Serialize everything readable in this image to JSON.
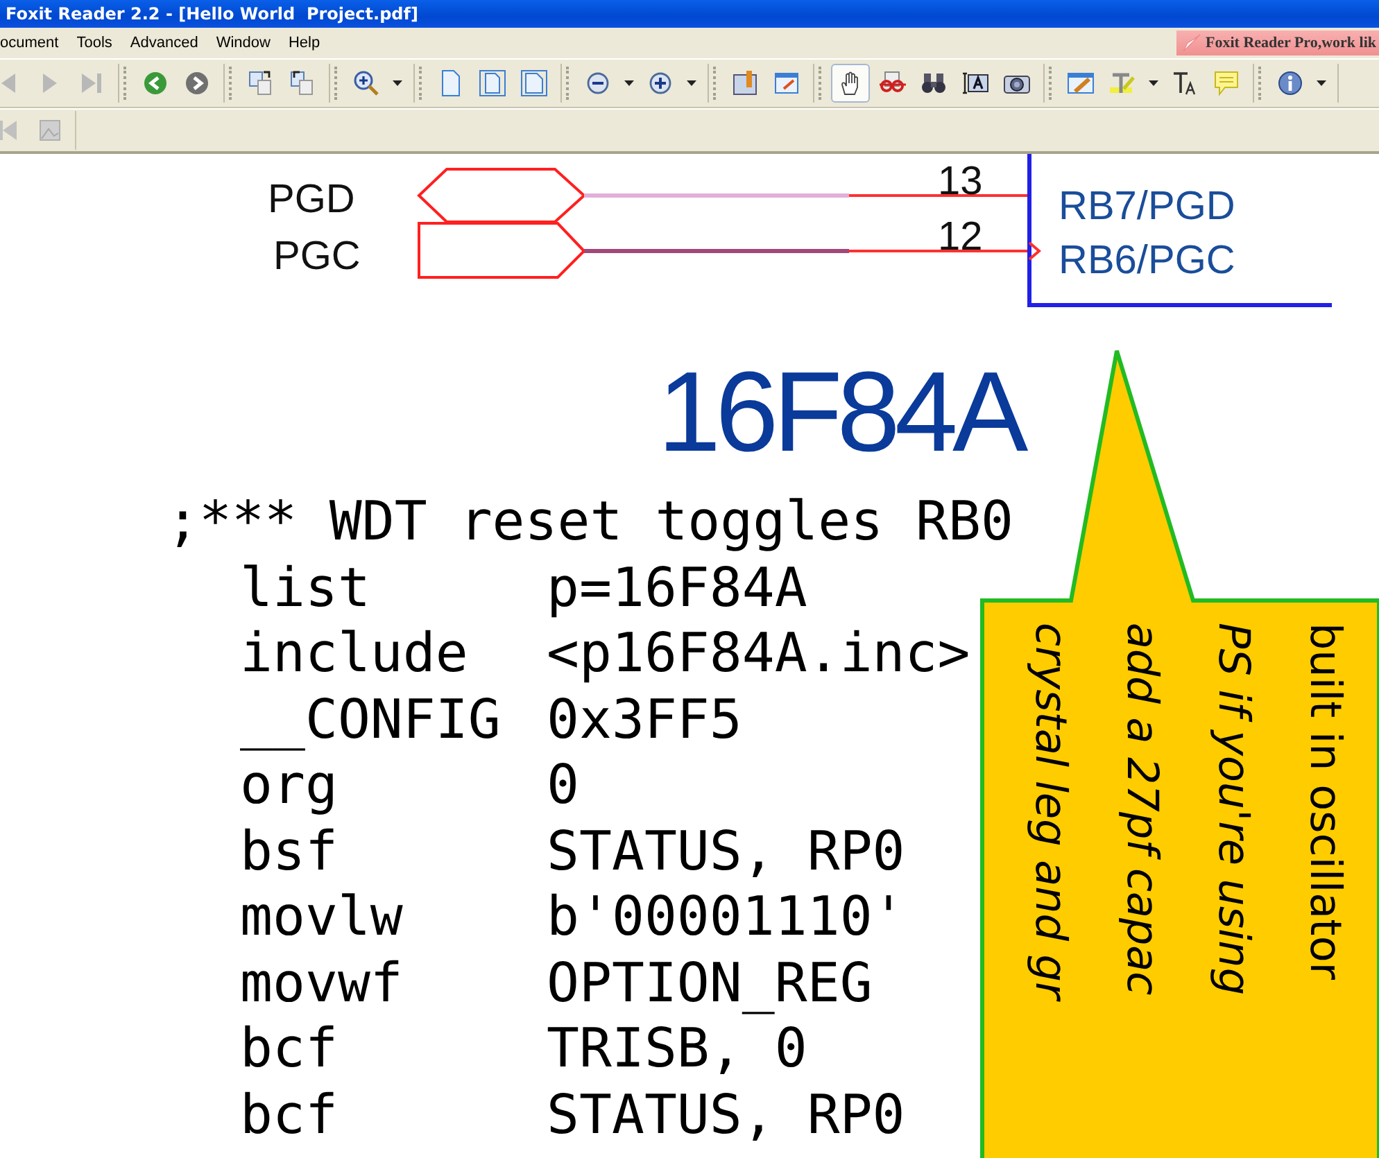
{
  "window": {
    "title": "Foxit Reader 2.2 - [Hello World  Project.pdf]"
  },
  "menu": [
    "ocument",
    "Tools",
    "Advanced",
    "Window",
    "Help"
  ],
  "promo": {
    "text": "Foxit Reader Pro,work lik"
  },
  "toolbar": {
    "groups": [
      {
        "tools": [
          {
            "kind": "prev",
            "selected": false
          },
          {
            "kind": "next",
            "selected": false
          },
          {
            "kind": "last",
            "selected": false
          }
        ]
      },
      {
        "tools": [
          {
            "kind": "back",
            "selected": false
          },
          {
            "kind": "forward",
            "selected": false
          }
        ]
      },
      {
        "tools": [
          {
            "kind": "rotate-cw",
            "selected": false
          },
          {
            "kind": "rotate-ccw",
            "selected": false
          }
        ]
      },
      {
        "tools": [
          {
            "kind": "zoom-tool",
            "selected": false,
            "dropdown": true
          }
        ]
      },
      {
        "tools": [
          {
            "kind": "page-single",
            "selected": false
          },
          {
            "kind": "page-continuous",
            "selected": false
          },
          {
            "kind": "page-facing",
            "selected": false
          }
        ]
      },
      {
        "tools": [
          {
            "kind": "zoom-out",
            "selected": false,
            "dropdown": true
          },
          {
            "kind": "zoom-in",
            "selected": false,
            "dropdown": true
          }
        ]
      },
      {
        "tools": [
          {
            "kind": "bookmarks",
            "selected": false
          },
          {
            "kind": "fullscreen",
            "selected": false
          }
        ]
      },
      {
        "tools": [
          {
            "kind": "hand",
            "selected": true
          },
          {
            "kind": "glasses",
            "selected": false
          },
          {
            "kind": "binoculars",
            "selected": false
          },
          {
            "kind": "text-select",
            "selected": false
          },
          {
            "kind": "camera",
            "selected": false
          }
        ]
      },
      {
        "tools": [
          {
            "kind": "edit-note",
            "selected": false
          },
          {
            "kind": "highlight",
            "selected": false,
            "dropdown": true
          },
          {
            "kind": "text-tool",
            "selected": false
          },
          {
            "kind": "comment",
            "selected": false
          }
        ]
      },
      {
        "tools": [
          {
            "kind": "info",
            "selected": false,
            "dropdown": true
          }
        ]
      }
    ]
  },
  "toolbar2": {
    "tools": [
      {
        "kind": "first-disabled",
        "selected": false
      },
      {
        "kind": "image-disabled",
        "selected": false
      }
    ]
  },
  "schematic": {
    "ports": [
      "PGD",
      "PGC"
    ],
    "pin_numbers": [
      "13",
      "12"
    ],
    "pin_names": [
      "RB7/PGD",
      "RB6/PGC"
    ]
  },
  "chip_title": "16F84A",
  "code": {
    "comment": ";*** WDT reset toggles RB0",
    "lines": [
      {
        "mnemonic": "list",
        "operand": "p=16F84A"
      },
      {
        "mnemonic": "include",
        "operand": "<p16F84A.inc>"
      },
      {
        "mnemonic": "__CONFIG",
        "operand": "0x3FF5"
      },
      {
        "mnemonic": "org",
        "operand": "0"
      },
      {
        "mnemonic": "bsf",
        "operand": "STATUS, RP0"
      },
      {
        "mnemonic": "movlw",
        "operand": "b'00001110'"
      },
      {
        "mnemonic": "movwf",
        "operand": "OPTION_REG"
      },
      {
        "mnemonic": "bcf",
        "operand": "TRISB, 0"
      },
      {
        "mnemonic": "bcf",
        "operand": "STATUS, RP0"
      }
    ]
  },
  "callout": {
    "lines": [
      {
        "text": "built in oscillator",
        "italic": false
      },
      {
        "text": "PS if you're using",
        "italic": true
      },
      {
        "text": "add a 27pf capac",
        "italic": true
      },
      {
        "text": "crystal leg and gr",
        "italic": true
      }
    ]
  }
}
